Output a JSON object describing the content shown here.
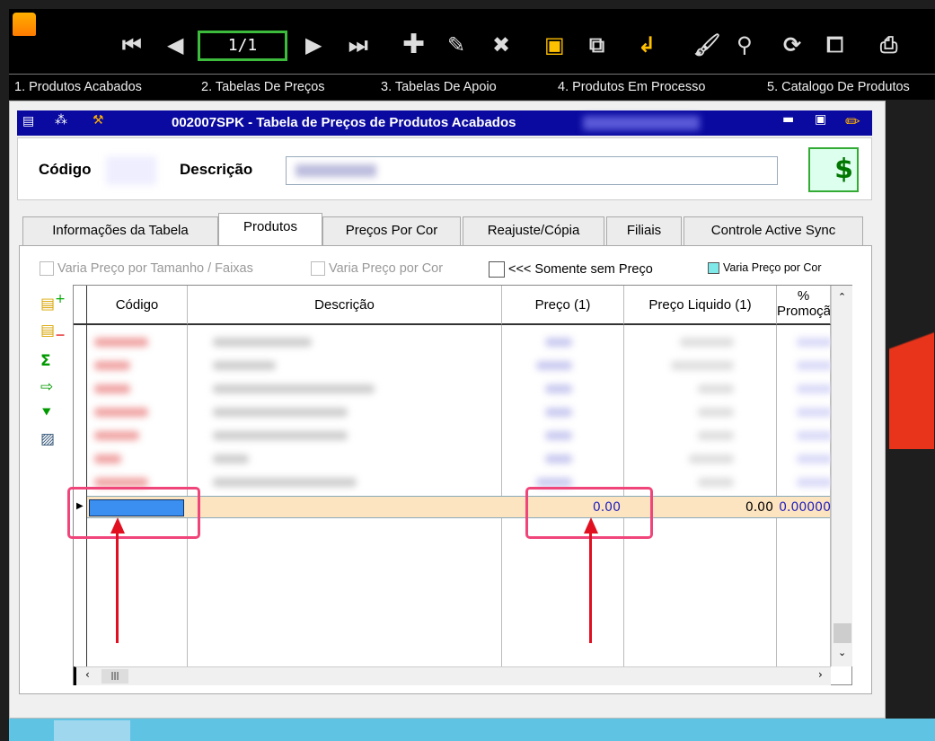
{
  "toolbar": {
    "pager": "1/1",
    "icons": [
      "app-logo-icon",
      "first-record-icon",
      "previous-record-icon",
      "next-record-icon",
      "last-record-icon",
      "add-icon",
      "edit-icon",
      "delete-icon",
      "save-icon",
      "copy-icon",
      "confirm-icon",
      "clear-icon",
      "search-icon",
      "refresh-icon",
      "preview-icon",
      "print-icon"
    ]
  },
  "menu": [
    "1. Produtos Acabados",
    "2. Tabelas De Preços",
    "3. Tabelas De Apoio",
    "4. Produtos Em Processo",
    "5. Catalogo De Produtos"
  ],
  "window": {
    "title": "002007SPK - Tabela de Preços de Produtos Acabados"
  },
  "header": {
    "codigo_label": "Código",
    "descricao_label": "Descrição"
  },
  "tabs": [
    "Informações da Tabela",
    "Produtos",
    "Preços Por Cor",
    "Reajuste/Cópia",
    "Filiais",
    "Controle Active Sync"
  ],
  "active_tab": "Produtos",
  "options": {
    "varia_tamanho": "Varia Preço por Tamanho / Faixas",
    "varia_cor": "Varia Preço por Cor",
    "somente_sem_preco": "<<< Somente sem Preço",
    "legend_varia_cor": "Varia Preço por Cor",
    "legend_color": "#7fe8e8"
  },
  "grid": {
    "columns": [
      "Código",
      "Descrição",
      "Preço (1)",
      "Preço Liquido (1)",
      "%\nPromoção"
    ],
    "new_row": {
      "codigo": "",
      "preco": "0.00",
      "preco_liquido": "0.00",
      "promocao": "0.00000"
    }
  },
  "colors": {
    "title_bar": "#0a0aa0",
    "new_row": "#fde4c0",
    "annotation": "#f0457a",
    "arrow": "#e01020"
  }
}
